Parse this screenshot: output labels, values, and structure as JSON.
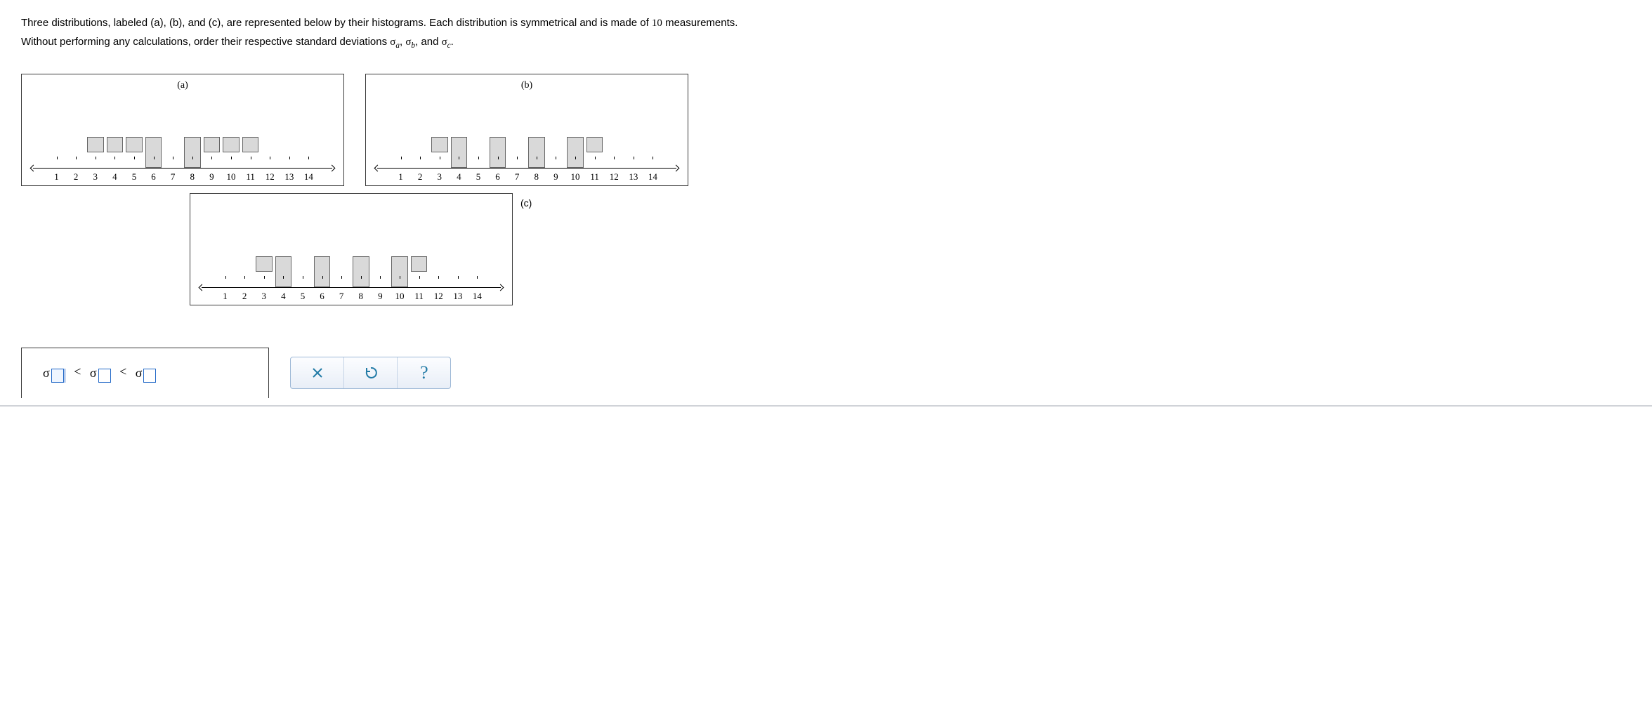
{
  "question": {
    "line1_pre": "Three distributions, labeled (a), (b), and (c), are represented below by their histograms. Each distribution is symmetrical and is made of ",
    "ten": "10",
    "line1_post": " measurements.",
    "line2_pre": "Without performing any calculations, order their respective standard deviations ",
    "sa": "σ",
    "sa_sub": "a",
    "comma1": ", ",
    "sb": "σ",
    "sb_sub": "b",
    "comma2": ", and ",
    "sc": "σ",
    "sc_sub": "c",
    "period": "."
  },
  "axis": [
    "1",
    "2",
    "3",
    "4",
    "5",
    "6",
    "7",
    "8",
    "9",
    "10",
    "11",
    "12",
    "13",
    "14"
  ],
  "chart_data": [
    {
      "type": "bar",
      "label": "(a)",
      "categories": [
        1,
        2,
        3,
        4,
        5,
        6,
        7,
        8,
        9,
        10,
        11,
        12,
        13,
        14
      ],
      "values": [
        0,
        0,
        1,
        1,
        1,
        2,
        0,
        2,
        1,
        1,
        1,
        0,
        0,
        0
      ],
      "xlim": [
        1,
        14
      ]
    },
    {
      "type": "bar",
      "label": "(b)",
      "categories": [
        1,
        2,
        3,
        4,
        5,
        6,
        7,
        8,
        9,
        10,
        11,
        12,
        13,
        14
      ],
      "values": [
        0,
        0,
        1,
        2,
        0,
        2,
        0,
        2,
        0,
        2,
        1,
        0,
        0,
        0
      ],
      "xlim": [
        1,
        14
      ]
    },
    {
      "type": "bar",
      "label": "(c)",
      "categories": [
        1,
        2,
        3,
        4,
        5,
        6,
        7,
        8,
        9,
        10,
        11,
        12,
        13,
        14
      ],
      "values": [
        0,
        0,
        1,
        2,
        0,
        2,
        0,
        2,
        0,
        2,
        1,
        0,
        0,
        0
      ],
      "xlim": [
        1,
        14
      ]
    }
  ],
  "answer": {
    "sigma": "σ",
    "lt": "<"
  },
  "buttons": {
    "clear": "×",
    "reset": "↺",
    "help": "?"
  }
}
